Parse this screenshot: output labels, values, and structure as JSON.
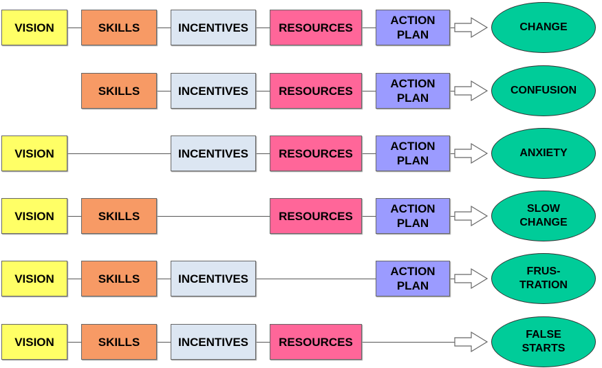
{
  "colors": {
    "vision": "#ffff66",
    "skills": "#f79a65",
    "incentives": "#dce6f2",
    "resources": "#ff6699",
    "action_plan": "#9b9bff",
    "outcome": "#00cc99"
  },
  "labels": {
    "vision": "VISION",
    "skills": "SKILLS",
    "incentives": "INCENTIVES",
    "resources": "RESOURCES",
    "action_plan_1": "ACTION",
    "action_plan_2": "PLAN"
  },
  "rows": [
    {
      "present": {
        "vision": true,
        "skills": true,
        "incentives": true,
        "resources": true,
        "action_plan": true
      },
      "outcome": [
        "CHANGE"
      ]
    },
    {
      "present": {
        "vision": false,
        "skills": true,
        "incentives": true,
        "resources": true,
        "action_plan": true
      },
      "outcome": [
        "CONFUSION"
      ]
    },
    {
      "present": {
        "vision": true,
        "skills": false,
        "incentives": true,
        "resources": true,
        "action_plan": true
      },
      "outcome": [
        "ANXIETY"
      ]
    },
    {
      "present": {
        "vision": true,
        "skills": true,
        "incentives": false,
        "resources": true,
        "action_plan": true
      },
      "outcome": [
        "SLOW",
        "CHANGE"
      ]
    },
    {
      "present": {
        "vision": true,
        "skills": true,
        "incentives": true,
        "resources": false,
        "action_plan": true
      },
      "outcome": [
        "FRUS-",
        "TRATION"
      ]
    },
    {
      "present": {
        "vision": true,
        "skills": true,
        "incentives": true,
        "resources": true,
        "action_plan": false
      },
      "outcome": [
        "FALSE",
        "STARTS"
      ]
    }
  ]
}
